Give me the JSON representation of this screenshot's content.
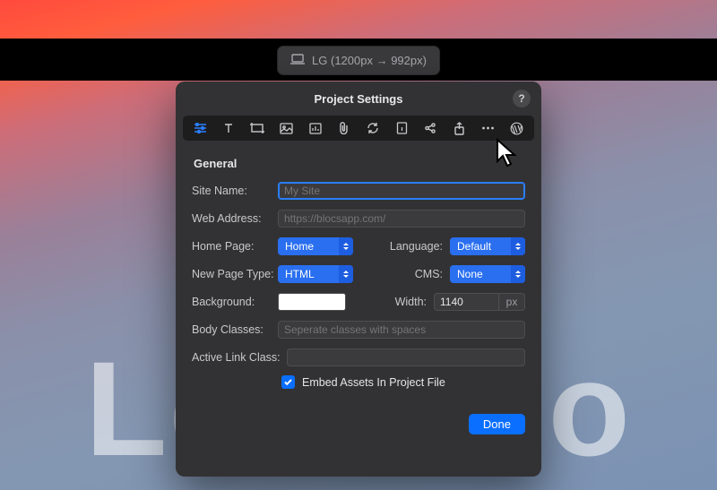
{
  "hero_text": "Let's Go",
  "breakpoint": {
    "label": "LG (1200px → 992px)"
  },
  "modal": {
    "title": "Project Settings",
    "help": "?",
    "section": "General",
    "labels": {
      "site_name": "Site Name:",
      "web_address": "Web Address:",
      "home_page": "Home Page:",
      "language": "Language:",
      "new_page_type": "New Page Type:",
      "cms": "CMS:",
      "background": "Background:",
      "width": "Width:",
      "body_classes": "Body Classes:",
      "active_link_class": "Active Link Class:"
    },
    "fields": {
      "site_name_placeholder": "My Site",
      "site_name_value": "",
      "web_address_placeholder": "https://blocsapp.com/",
      "web_address_value": "",
      "home_page": "Home",
      "language": "Default",
      "new_page_type": "HTML",
      "cms": "None",
      "background_color": "#ffffff",
      "width_value": "1140",
      "width_unit": "px",
      "body_classes_placeholder": "Seperate classes with spaces",
      "body_classes_value": "",
      "active_link_class_value": ""
    },
    "embed_checkbox": {
      "checked": true,
      "label": "Embed Assets In Project File"
    },
    "done_label": "Done"
  },
  "toolbar_icons": [
    "general-icon",
    "typography-icon",
    "crop-icon",
    "image-icon",
    "analytics-icon",
    "attachment-icon",
    "refresh-icon",
    "info-icon",
    "share-icon",
    "export-icon",
    "more-icon",
    "wordpress-icon"
  ]
}
